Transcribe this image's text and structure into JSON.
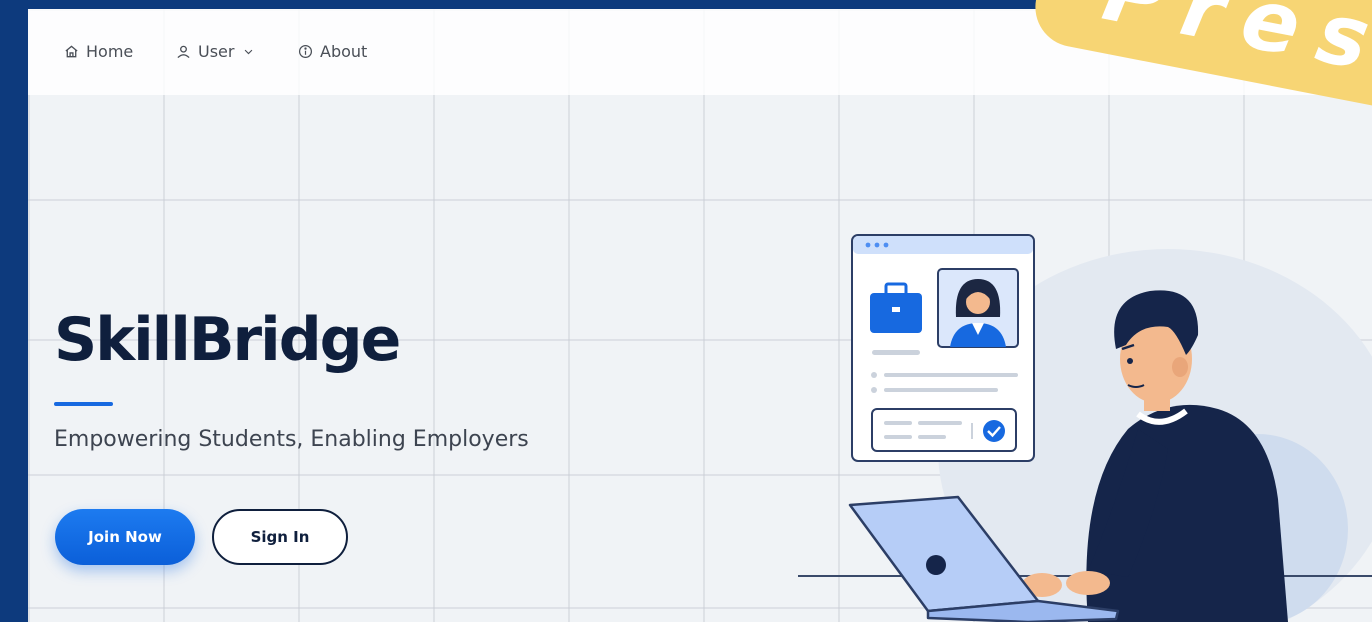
{
  "nav": {
    "items": [
      {
        "label": "Home",
        "icon": "home-icon"
      },
      {
        "label": "User",
        "icon": "user-icon",
        "dropdown": true
      },
      {
        "label": "About",
        "icon": "info-icon"
      }
    ]
  },
  "hero": {
    "title": "SkillBridge",
    "subtitle": "Empowering Students, Enabling Employers",
    "primary_button": "Join Now",
    "secondary_button": "Sign In"
  },
  "badge": {
    "text": "Pres"
  },
  "colors": {
    "frame_border": "#0d3a7d",
    "accent_blue": "#1769e0",
    "title_navy": "#0f1f3d",
    "badge_yellow": "#f7d574"
  }
}
